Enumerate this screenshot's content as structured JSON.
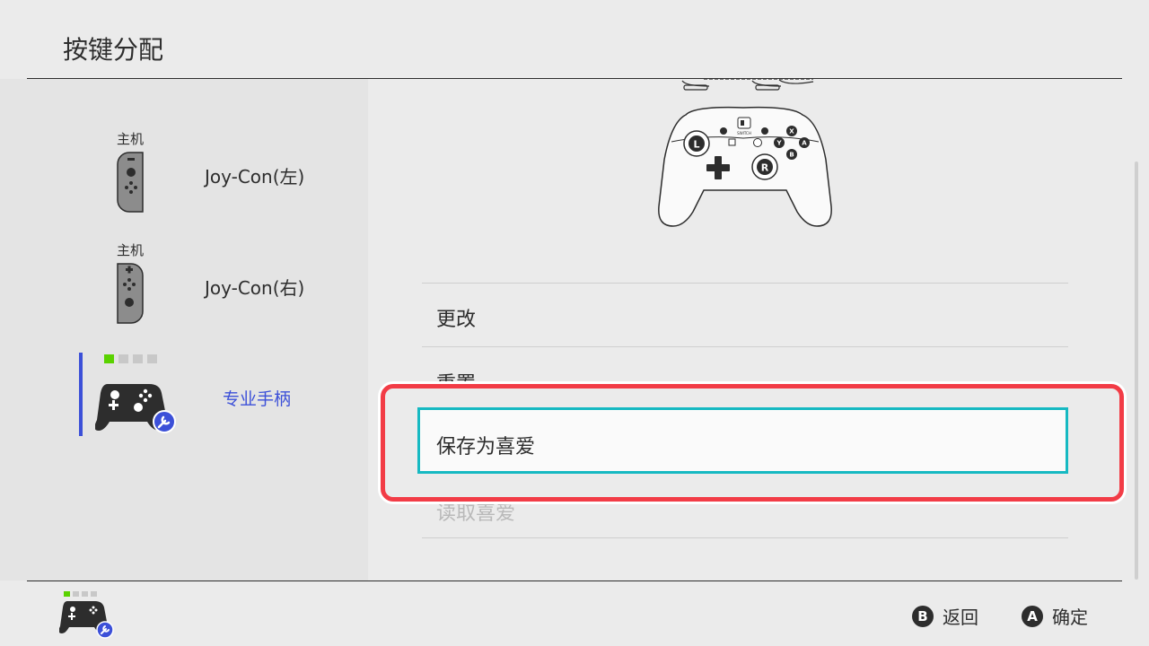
{
  "header": {
    "title": "按键分配"
  },
  "devices": [
    {
      "label": "主机",
      "name": "Joy-Con(左)",
      "icon": "joycon-left-icon"
    },
    {
      "label": "主机",
      "name": "Joy-Con(右)",
      "icon": "joycon-right-icon"
    },
    {
      "name": "专业手柄",
      "icon": "pro-controller-icon",
      "badge": "wrench-icon",
      "player_lights": [
        true,
        false,
        false,
        false
      ]
    }
  ],
  "menu": {
    "items": [
      {
        "label": "更改"
      },
      {
        "label": "重置"
      },
      {
        "label": "保存为喜爱",
        "selected": true
      },
      {
        "label": "读取喜爱",
        "dimmed": true
      }
    ]
  },
  "footer": {
    "controller_icon": "pro-controller-icon",
    "player_lights": [
      true,
      false,
      false,
      false
    ],
    "hints": [
      {
        "button": "B",
        "label": "返回"
      },
      {
        "button": "A",
        "label": "确定"
      }
    ]
  },
  "colors": {
    "accent": "#3c50d8",
    "selection_border": "#16b9c2",
    "highlight": "#f23c46",
    "player_light": "#5ad200"
  }
}
